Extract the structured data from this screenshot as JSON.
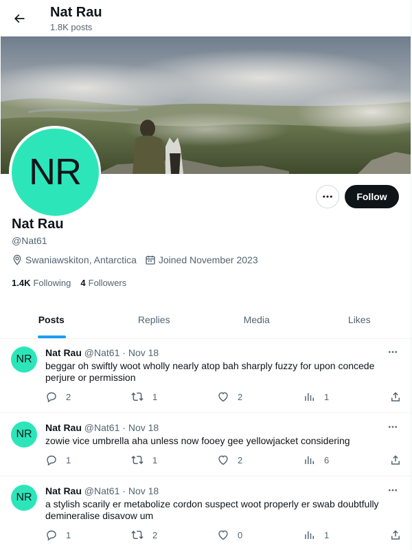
{
  "header": {
    "title": "Nat Rau",
    "subtitle": "1.8K posts",
    "back_icon": "arrow-left-icon"
  },
  "profile": {
    "avatar_initials": "NR",
    "name": "Nat Rau",
    "handle": "@Nat61",
    "location": "Swaniawskiton, Antarctica",
    "joined": "Joined November 2023",
    "following_count": "1.4K",
    "following_label": "Following",
    "followers_count": "4",
    "followers_label": "Followers",
    "follow_label": "Follow",
    "avatar_color": "#2ce6b9"
  },
  "tabs": [
    {
      "label": "Posts",
      "active": true
    },
    {
      "label": "Replies",
      "active": false
    },
    {
      "label": "Media",
      "active": false
    },
    {
      "label": "Likes",
      "active": false
    }
  ],
  "posts": [
    {
      "initials": "NR",
      "name": "Nat Rau",
      "handle": "@Nat61",
      "dot": "·",
      "date": "Nov 18",
      "text": "beggar oh swiftly woot wholly nearly atop bah sharply fuzzy for upon concede perjure or permission",
      "replies": "2",
      "reposts": "1",
      "likes": "2",
      "views": "1"
    },
    {
      "initials": "NR",
      "name": "Nat Rau",
      "handle": "@Nat61",
      "dot": "·",
      "date": "Nov 18",
      "text": "zowie vice umbrella aha unless now fooey gee yellowjacket considering",
      "replies": "1",
      "reposts": "1",
      "likes": "2",
      "views": "6"
    },
    {
      "initials": "NR",
      "name": "Nat Rau",
      "handle": "@Nat61",
      "dot": "·",
      "date": "Nov 18",
      "text": "a stylish scarily er metabolize cordon suspect woot properly er swab doubtfully demineralise disavow um",
      "replies": "1",
      "reposts": "2",
      "likes": "0",
      "views": "1"
    }
  ],
  "colors": {
    "accent": "#1d9bf0",
    "text_primary": "#0f1419",
    "text_secondary": "#536471",
    "follow_bg": "#0f1419"
  }
}
